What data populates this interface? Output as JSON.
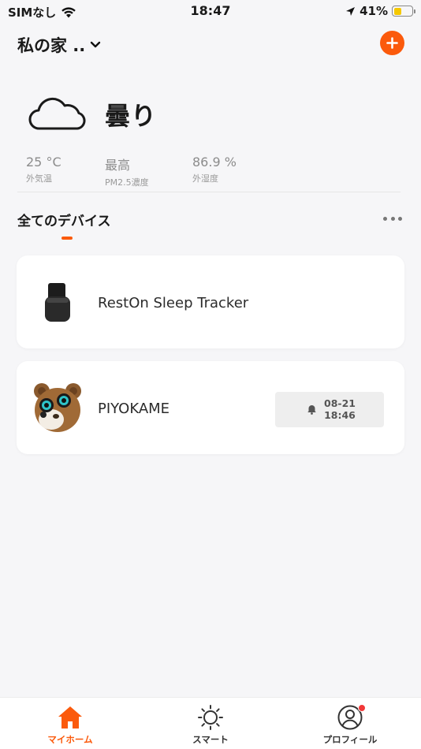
{
  "status_bar": {
    "carrier": "SIMなし",
    "time": "18:47",
    "battery_percent": "41%",
    "battery_level": 0.41,
    "battery_color": "#f5c800"
  },
  "header": {
    "home_name": "私の家 ..",
    "add_icon": "plus-icon"
  },
  "weather": {
    "condition": "曇り",
    "icon": "cloud-icon",
    "stats": [
      {
        "value": "25 °C",
        "label": "外気温"
      },
      {
        "value": "最高",
        "label": "PM2.5濃度"
      },
      {
        "value": "86.9 %",
        "label": "外湿度"
      }
    ]
  },
  "devices_section": {
    "title": "全てのデバイス"
  },
  "devices": [
    {
      "name": "RestOn Sleep Tracker",
      "icon": "sleep-tracker-device"
    },
    {
      "name": "PIYOKAME",
      "icon": "bear-robot",
      "alert_date": "08-21",
      "alert_time": "18:46",
      "alert_icon": "bell-icon"
    }
  ],
  "tabs": [
    {
      "label": "マイホーム",
      "icon": "home-icon",
      "active": true
    },
    {
      "label": "スマート",
      "icon": "sun-icon",
      "active": false
    },
    {
      "label": "プロフィール",
      "icon": "profile-icon",
      "active": false,
      "badge": true
    }
  ],
  "colors": {
    "accent": "#fb5a0c",
    "background": "#f6f6f8",
    "badge": "#f23838"
  }
}
